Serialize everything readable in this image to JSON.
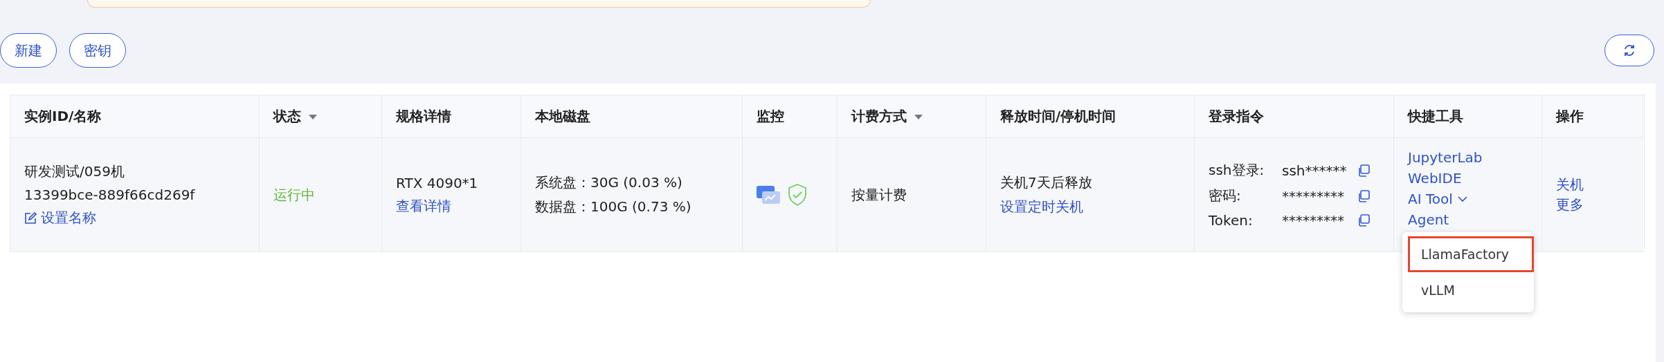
{
  "toolbar": {
    "buttons": [
      "新建",
      "密钥"
    ]
  },
  "table": {
    "columns": [
      {
        "label": "实例ID/名称",
        "filter": false
      },
      {
        "label": "状态",
        "filter": true
      },
      {
        "label": "规格详情",
        "filter": false
      },
      {
        "label": "本地磁盘",
        "filter": false
      },
      {
        "label": "监控",
        "filter": false
      },
      {
        "label": "计费方式",
        "filter": true
      },
      {
        "label": "释放时间/停机时间",
        "filter": false
      },
      {
        "label": "登录指令",
        "filter": false
      },
      {
        "label": "快捷工具",
        "filter": false
      },
      {
        "label": "操作",
        "filter": false
      }
    ],
    "rows": [
      {
        "name": "研发测试/059机",
        "id": "13399bce-889f66cd269f",
        "rename": "设置名称",
        "status": "运行中",
        "spec": "RTX 4090*1",
        "spec_link": "查看详情",
        "disks": [
          "系统盘：30G (0.03 %)",
          "数据盘：100G (0.73 %)"
        ],
        "billing": "按量计费",
        "release": "关机7天后释放",
        "release_link": "设置定时关机",
        "login": [
          {
            "label": "ssh登录:",
            "value": "ssh******"
          },
          {
            "label": "密码:",
            "value": "*********"
          },
          {
            "label": "Token:",
            "value": "*********"
          }
        ],
        "tools": [
          {
            "label": "JupyterLab",
            "kind": "link"
          },
          {
            "label": "WebIDE",
            "kind": "link"
          },
          {
            "label": "AI Tool",
            "kind": "dropdown"
          },
          {
            "label": "Agent",
            "kind": "link"
          }
        ],
        "dropdown": [
          {
            "label": "LlamaFactory",
            "selected": true
          },
          {
            "label": "vLLM",
            "selected": false
          }
        ],
        "actions": [
          "关机",
          "更多"
        ]
      }
    ]
  }
}
